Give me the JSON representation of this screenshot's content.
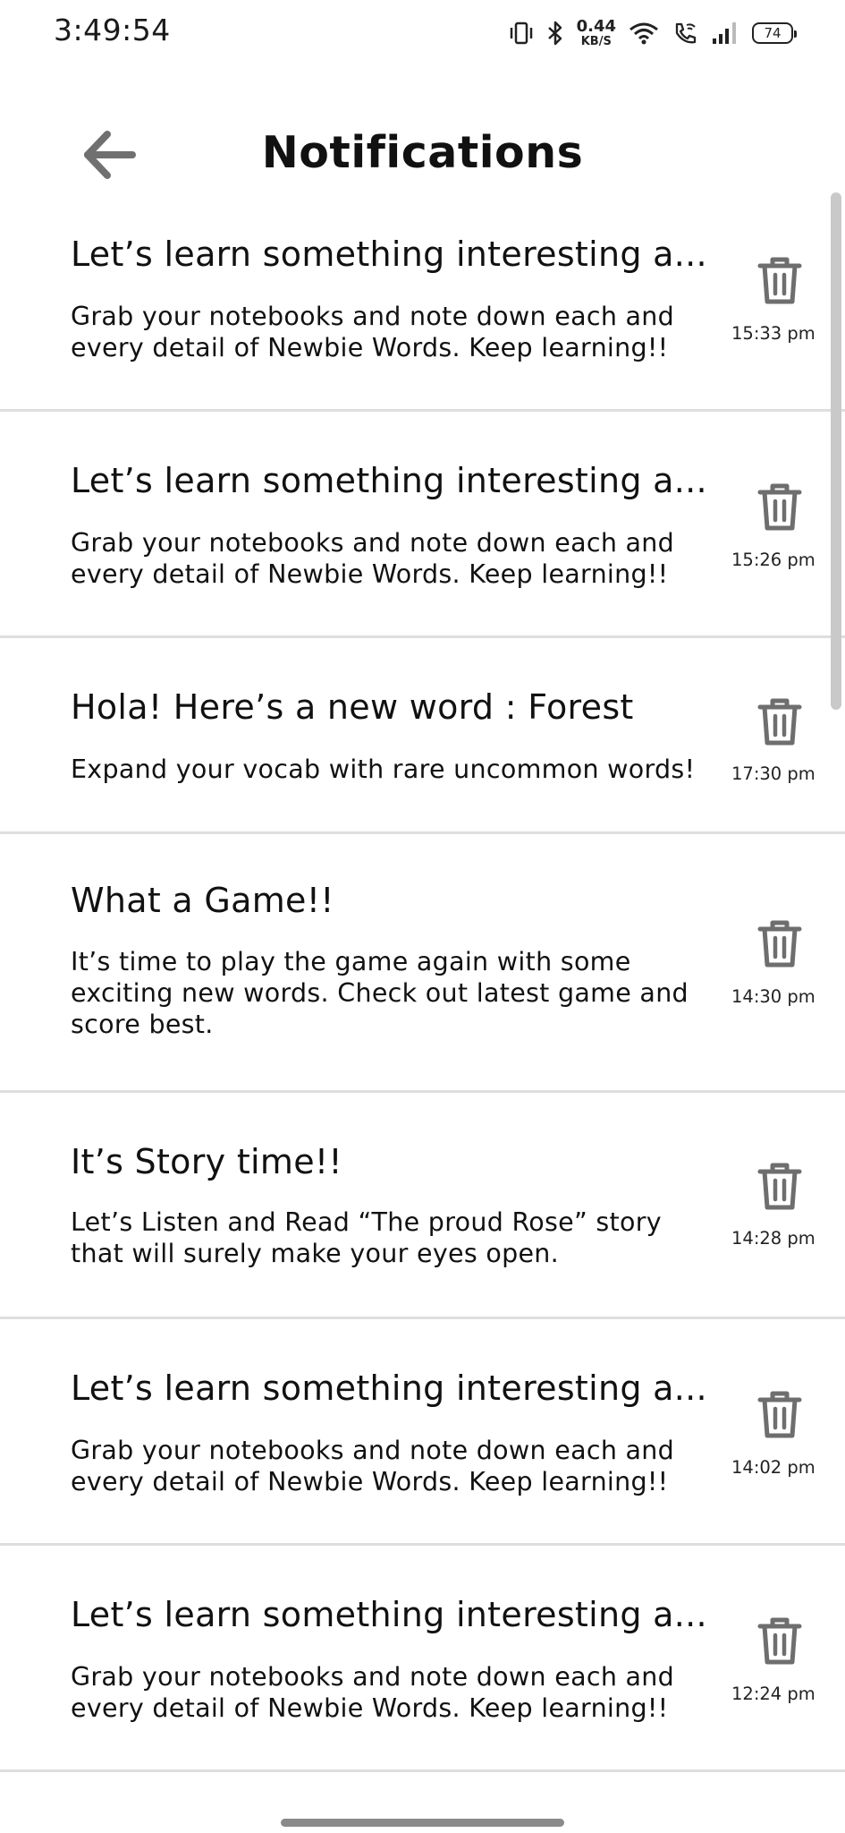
{
  "status_bar": {
    "time": "3:49:54",
    "net_speed_value": "0.44",
    "net_speed_unit": "KB/S",
    "battery": "74",
    "icons": [
      "vibrate-icon",
      "bluetooth-icon",
      "wifi-icon",
      "wifi-call-icon",
      "signal-icon",
      "battery-icon"
    ]
  },
  "header": {
    "title": "Notifications",
    "back_icon": "arrow-left-icon"
  },
  "notifications": [
    {
      "title": "Let’s learn something interesting a...",
      "body": "Grab your notebooks and note down each and every detail of Newbie Words. Keep learning!!",
      "time": "15:33 pm"
    },
    {
      "title": "Let’s learn something interesting a...",
      "body": "Grab your notebooks and note down each and every detail of Newbie Words. Keep learning!!",
      "time": "15:26 pm"
    },
    {
      "title": "Hola! Here’s a new word : Forest",
      "body": "Expand your vocab with rare uncommon words!",
      "time": "17:30 pm"
    },
    {
      "title": "What a Game!!",
      "body": "It’s time to play the game again with some exciting new words. Check out latest game and score best.",
      "time": "14:30 pm"
    },
    {
      "title": "It’s Story time!!",
      "body": "Let’s Listen and Read “The proud Rose” story that will surely make your eyes open.",
      "time": "14:28 pm"
    },
    {
      "title": "Let’s learn something interesting a...",
      "body": "Grab your notebooks and note down each and every detail of Newbie Words. Keep learning!!",
      "time": "14:02 pm"
    },
    {
      "title": "Let’s learn something interesting a...",
      "body": "Grab your notebooks and note down each and every detail of Newbie Words. Keep learning!!",
      "time": "12:24 pm"
    }
  ],
  "colors": {
    "text": "#111111",
    "icon_gray": "#6e6e6e",
    "divider": "#dedede"
  }
}
